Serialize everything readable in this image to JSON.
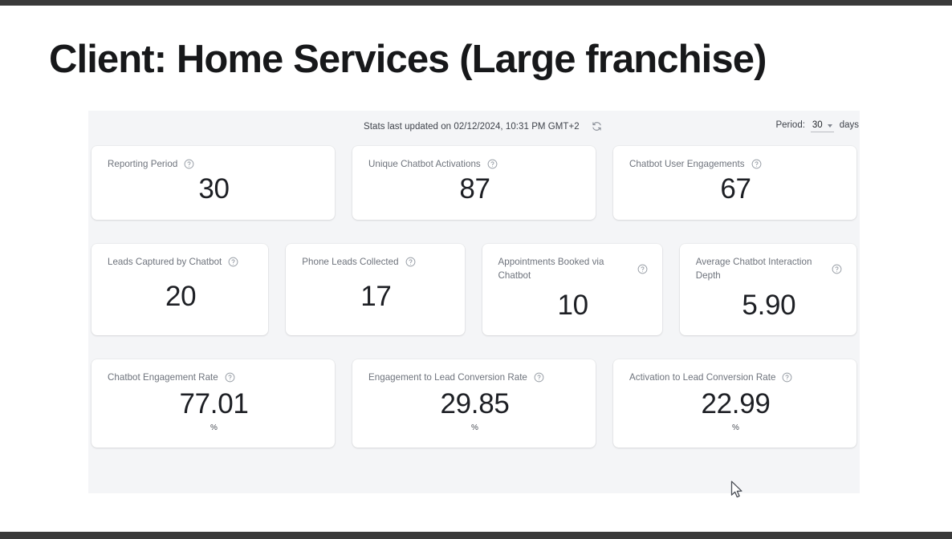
{
  "slide": {
    "headline": "Client: Home Services (Large franchise)"
  },
  "dashboard": {
    "status_text": "Stats last updated on 02/12/2024, 10:31 PM GMT+2",
    "refresh_icon": "refresh-icon",
    "period": {
      "label": "Period:",
      "value": "30",
      "unit": "days",
      "caret_icon": "chevron-down-icon"
    },
    "help_icon": "help-circle-icon",
    "colors": {
      "panel_bg": "#f4f5f7",
      "card_bg": "#ffffff",
      "label_text": "#6e737c",
      "value_text": "#1d1f24",
      "headline_text": "#17181a"
    },
    "rows": [
      {
        "cards": [
          {
            "label": "Reporting Period",
            "value": "30",
            "unit": ""
          },
          {
            "label": "Unique Chatbot Activations",
            "value": "87",
            "unit": ""
          },
          {
            "label": "Chatbot User Engagements",
            "value": "67",
            "unit": ""
          }
        ]
      },
      {
        "cards": [
          {
            "label": "Leads Captured by Chatbot",
            "value": "20",
            "unit": ""
          },
          {
            "label": "Phone Leads Collected",
            "value": "17",
            "unit": ""
          },
          {
            "label": "Appointments Booked via Chatbot",
            "value": "10",
            "unit": ""
          },
          {
            "label": "Average Chatbot Interaction Depth",
            "value": "5.90",
            "unit": ""
          }
        ]
      },
      {
        "cards": [
          {
            "label": "Chatbot Engagement Rate",
            "value": "77.01",
            "unit": "%"
          },
          {
            "label": "Engagement to Lead Conversion Rate",
            "value": "29.85",
            "unit": "%"
          },
          {
            "label": "Activation to Lead Conversion Rate",
            "value": "22.99",
            "unit": "%"
          }
        ]
      }
    ]
  }
}
